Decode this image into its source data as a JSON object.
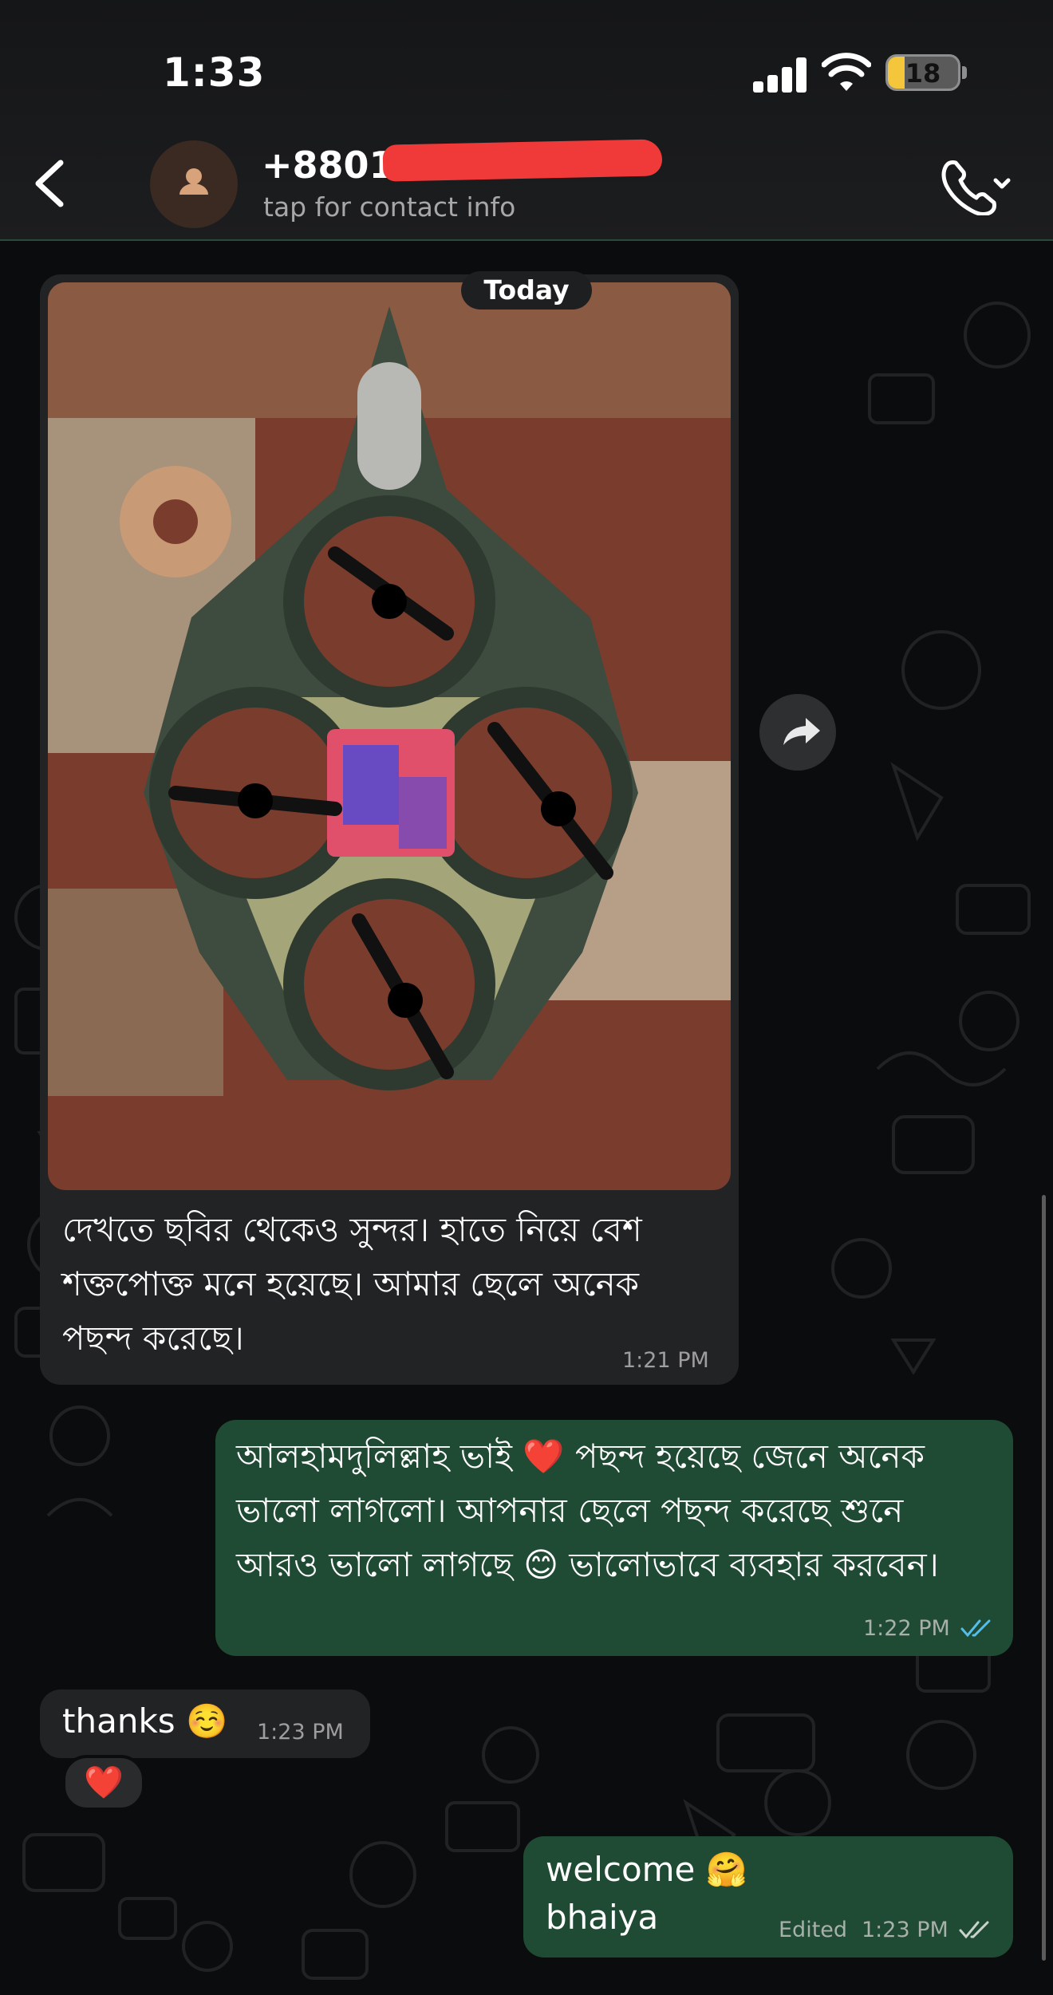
{
  "status_bar": {
    "time": "1:33",
    "battery_level": "18"
  },
  "header": {
    "contact_number": "+88018",
    "contact_subtitle": "tap for contact info"
  },
  "chat": {
    "date_separator": "Today",
    "messages": [
      {
        "direction": "incoming",
        "has_image": true,
        "image_description_icon": "photo",
        "text": "দেখতে ছবির থেকেও সুন্দর। হাতে নিয়ে বেশ\nশক্তপোক্ত মনে হয়েছে। আমার ছেলে অনেক\nপছন্দ করেছে।",
        "time": "1:21 PM"
      },
      {
        "direction": "outgoing",
        "text": "আলহামদুলিল্লাহ ভাই ❤️ পছন্দ হয়েছে জেনে অনেক\nভালো লাগলো। আপনার ছেলে পছন্দ করেছে শুনে\nআরও ভালো লাগছে 😊 ভালোভাবে ব্যবহার করবেন।",
        "time": "1:22 PM",
        "status": "read"
      },
      {
        "direction": "incoming",
        "text": "thanks ☺️",
        "time": "1:23 PM",
        "reaction": "❤️"
      },
      {
        "direction": "outgoing",
        "text": "welcome 🤗\nbhaiya",
        "edited_label": "Edited",
        "time": "1:23 PM",
        "status": "delivered"
      }
    ]
  },
  "colors": {
    "incoming_bubble": "#222325",
    "outgoing_bubble": "#1f4a33",
    "read_ticks": "#53bdeb",
    "battery": "#f3c63c",
    "redaction": "#f03a3a"
  }
}
